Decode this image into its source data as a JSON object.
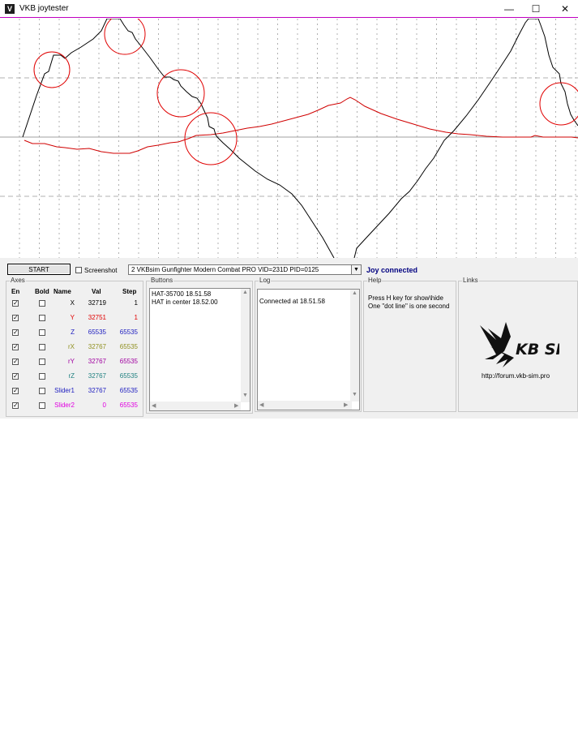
{
  "window": {
    "title": "VKB joytester",
    "minimize": "—",
    "maximize": "☐",
    "close": "✕"
  },
  "toolbar": {
    "start_label": "START",
    "screenshot_label": "Screenshot",
    "device": "2 VKBsim Gunfighter Modern Combat PRO  VID=231D PID=0125",
    "status": "Joy connected",
    "status_color": "#000080"
  },
  "axes": {
    "title": "Axes",
    "headers": {
      "en": "En",
      "bold": "Bold",
      "name": "Name",
      "val": "Val",
      "step": "Step"
    },
    "rows": [
      {
        "name": "X",
        "val": "32719",
        "step": "1",
        "color": "#000000"
      },
      {
        "name": "Y",
        "val": "32751",
        "step": "1",
        "color": "#e00000"
      },
      {
        "name": "Z",
        "val": "65535",
        "step": "65535",
        "color": "#2020c0"
      },
      {
        "name": "rX",
        "val": "32767",
        "step": "65535",
        "color": "#909020"
      },
      {
        "name": "rY",
        "val": "32767",
        "step": "65535",
        "color": "#a000a0"
      },
      {
        "name": "rZ",
        "val": "32767",
        "step": "65535",
        "color": "#208080"
      },
      {
        "name": "Slider1",
        "val": "32767",
        "step": "65535",
        "color": "#2020c0"
      },
      {
        "name": "Slider2",
        "val": "0",
        "step": "65535",
        "color": "#e000e0"
      }
    ]
  },
  "buttons": {
    "title": "Buttons",
    "lines": [
      "HAT-35700 18.51.58",
      "HAT in center 18.52.00"
    ]
  },
  "log": {
    "title": "Log",
    "lines": [
      "Connected at 18.51.58"
    ]
  },
  "help": {
    "title": "Help",
    "lines": [
      "Press H key for show\\hide",
      "One \"dot line\" is one second"
    ]
  },
  "links": {
    "title": "Links",
    "logo_text": "KB SIM",
    "url": "http://forum.vkb-sim.pro"
  },
  "graph": {
    "black_curve_color": "#000000",
    "red_curve_color": "#d00000",
    "circle_color": "#e00000",
    "grid_color": "#b0b0b0",
    "center_line_color": "#a0a0a0",
    "top_line_color": "#c000c0"
  }
}
